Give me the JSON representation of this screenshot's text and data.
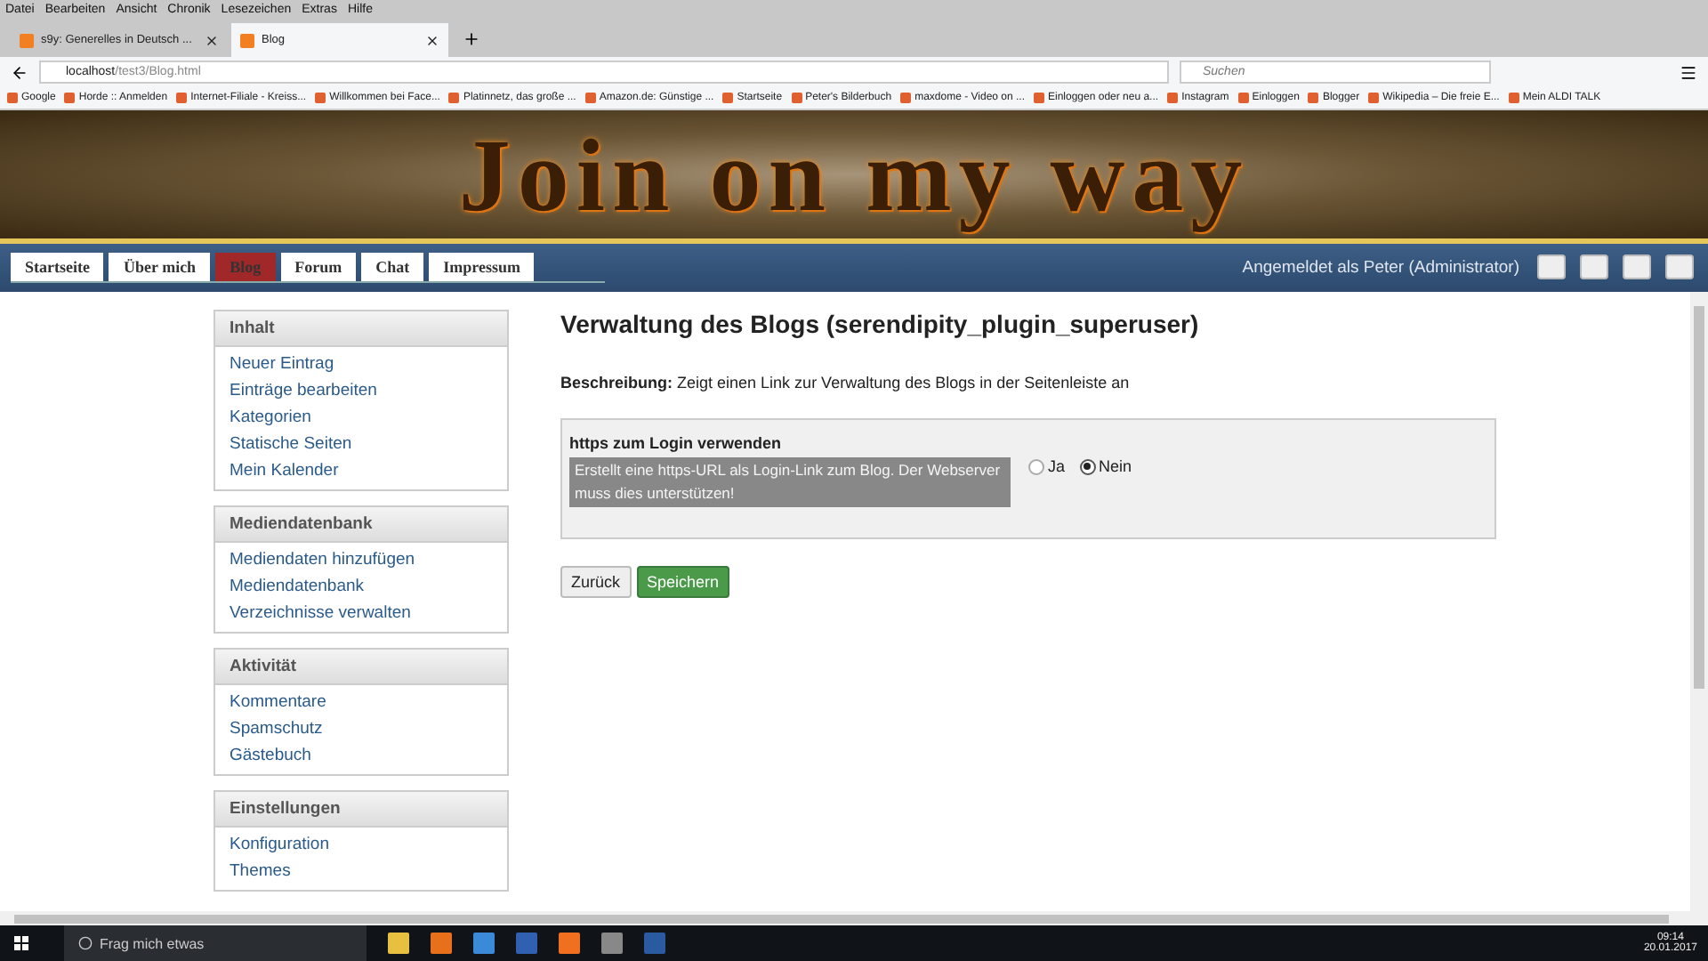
{
  "menu_bar": [
    "Datei",
    "Bearbeiten",
    "Ansicht",
    "Chronik",
    "Lesezeichen",
    "Extras",
    "Hilfe"
  ],
  "tabs": [
    {
      "label": "s9y: Generelles in Deutsch ...",
      "selected": false
    },
    {
      "label": "Blog",
      "selected": true
    }
  ],
  "address_bar": {
    "host": "localhost",
    "path": "/test3/Blog.html"
  },
  "search": {
    "placeholder": "Suchen"
  },
  "bookmarks": [
    "Google",
    "Horde :: Anmelden",
    "Internet-Filiale - Kreiss...",
    "Willkommen bei Face...",
    "Platinnetz, das große ...",
    "Amazon.de: Günstige ...",
    "Startseite",
    "Peter's Bilderbuch",
    "maxdome - Video on ...",
    "Einloggen oder neu a...",
    "Instagram",
    "Einloggen",
    "Blogger",
    "Wikipedia – Die freie E...",
    "Mein ALDI TALK"
  ],
  "banner": {
    "title": "Join on my way"
  },
  "nav": [
    {
      "label": "Startseite",
      "selected": false
    },
    {
      "label": "Über mich",
      "selected": false
    },
    {
      "label": "Blog",
      "selected": true
    },
    {
      "label": "Forum",
      "selected": false
    },
    {
      "label": "Chat",
      "selected": false
    },
    {
      "label": "Impressum",
      "selected": false
    }
  ],
  "login_status": "Angemeldet als Peter (Administrator)",
  "sidebar": [
    {
      "heading": "Inhalt",
      "items": [
        "Neuer Eintrag",
        "Einträge bearbeiten",
        "Kategorien",
        "Statische Seiten",
        "Mein Kalender"
      ]
    },
    {
      "heading": "Mediendatenbank",
      "items": [
        "Mediendaten hinzufügen",
        "Mediendatenbank",
        "Verzeichnisse verwalten"
      ]
    },
    {
      "heading": "Aktivität",
      "items": [
        "Kommentare",
        "Spamschutz",
        "Gästebuch"
      ]
    },
    {
      "heading": "Einstellungen",
      "items": [
        "Konfiguration",
        "Themes"
      ]
    }
  ],
  "main": {
    "title": "Verwaltung des Blogs (serendipity_plugin_superuser)",
    "description": "**Beschreibung:** Zeigt einen Link zur Verwaltung des Blogs in der Seitenleiste an",
    "option": {
      "label": "https zum Login verwenden",
      "help": "Erstellt eine https-URL als Login-Link zum Blog. Der Webserver muss dies unterstützen!",
      "choices": [
        {
          "label": "Ja",
          "selected": false
        },
        {
          "label": "Nein",
          "selected": true
        }
      ]
    },
    "buttons": [
      {
        "label": "Zurück",
        "kind": "default"
      },
      {
        "label": "Speichern",
        "kind": "primary"
      }
    ]
  },
  "taskbar": {
    "search_placeholder": "Frag mich etwas",
    "time": "09:14",
    "date": "20.01.2017"
  }
}
